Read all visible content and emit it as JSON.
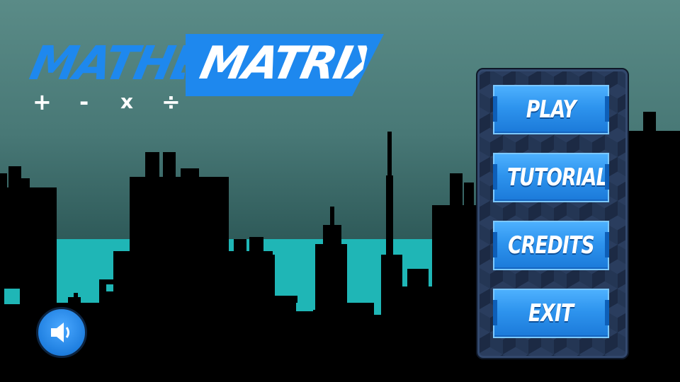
{
  "game": {
    "title_part1": "MATHE",
    "title_part2": "MATRIX",
    "operators": {
      "plus": "+",
      "minus": "-",
      "times": "x",
      "divide": "÷"
    }
  },
  "menu": {
    "play_label": "PLAY",
    "tutorial_label": "TUTORIAL",
    "credits_label": "CREDITS",
    "exit_label": "EXIT"
  },
  "controls": {
    "sound_icon": "speaker-icon"
  },
  "colors": {
    "accent_blue": "#1e88ee",
    "sky_top": "#5a8b87",
    "water": "#1fb6b6",
    "panel": "#1c2a44",
    "silhouette": "#000000"
  }
}
